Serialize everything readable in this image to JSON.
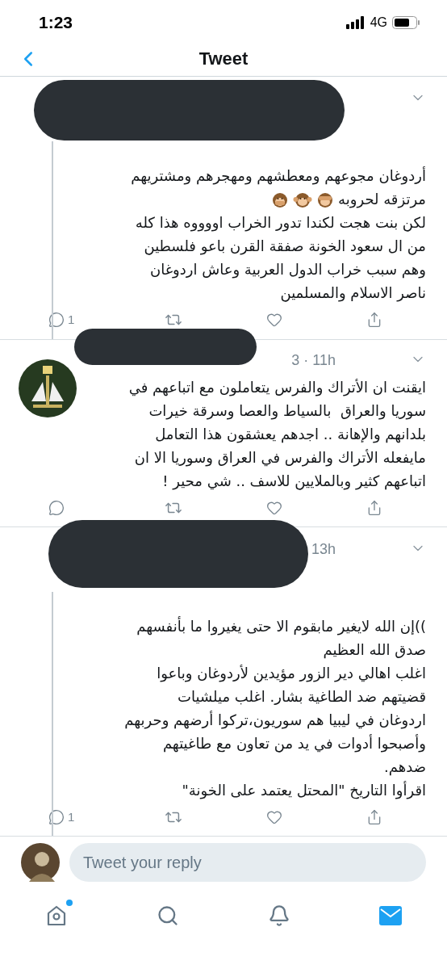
{
  "status_bar": {
    "time": "1:23",
    "network": "4G"
  },
  "header": {
    "title": "Tweet"
  },
  "tweets": [
    {
      "thread_line": true,
      "reply_count": "1",
      "lines": [
        {
          "text": "أردوغان مجوعهم ومعطشهم ومهجرهم ومشتريهم"
        },
        {
          "text": "مرتزقه لحروبه",
          "emojis": [
            {
              "kind": "see_no_evil"
            },
            {
              "kind": "hear_no_evil"
            },
            {
              "kind": "speak_no_evil"
            }
          ]
        },
        {
          "text": "لكن بنت هجت لكندا تدور الخراب اووووه هذا كله"
        },
        {
          "text": "من ال سعود الخونة صفقة القرن باعو فلسطين"
        },
        {
          "text": "وهم سبب خراب الدول العربية وعاش اردوغان"
        },
        {
          "text": "ناصر الاسلام والمسلمين"
        }
      ]
    },
    {
      "timestamp": "3 · 11h",
      "thread_line": false,
      "avatar": true,
      "lines": [
        {
          "text": "ايقنت ان الأتراك والفرس يتعاملون مع اتباعهم في"
        },
        {
          "text": "سوريا والعراق  بالسياط والعصا وسرقة خيرات"
        },
        {
          "text": "بلدانهم والإهانة .. اجدهم يعشقون هذا التعامل"
        },
        {
          "text": "مايفعله الأتراك والفرس في العراق وسوريا الا ان"
        },
        {
          "text": "اتباعهم كثير وبالملايين للاسف .. شي محير !"
        }
      ]
    },
    {
      "timestamp": "13h",
      "thread_line": true,
      "reply_count": "1",
      "lines": [
        {
          "text": "))إن الله لايغير مابقوم الا حتى يغيروا ما بأنفسهم"
        },
        {
          "text": "صدق الله العظيم"
        },
        {
          "text": "اغلب اهالي دير الزور مؤيدين لأردوغان وباعوا"
        },
        {
          "text": "قضيتهم ضد الطاغية بشار. اغلب ميلشيات"
        },
        {
          "text": "اردوغان في ليبيا هم سوريون،تركوا أرضهم وحربهم"
        },
        {
          "text": "وأصبحوا أدوات في يد من تعاون مع طاغيتهم"
        },
        {
          "text": "ضدهم."
        },
        {
          "text": "اقرأوا التاريخ \"المحتل يعتمد على الخونة\""
        }
      ]
    }
  ],
  "reply_bar": {
    "placeholder": "Tweet your reply"
  },
  "tab_bar": [
    {
      "kind": "home",
      "selected": false,
      "badge": true
    },
    {
      "kind": "search",
      "selected": false,
      "badge": false
    },
    {
      "kind": "notifications",
      "selected": false,
      "badge": false
    },
    {
      "kind": "messages",
      "selected": true,
      "badge": false
    }
  ]
}
